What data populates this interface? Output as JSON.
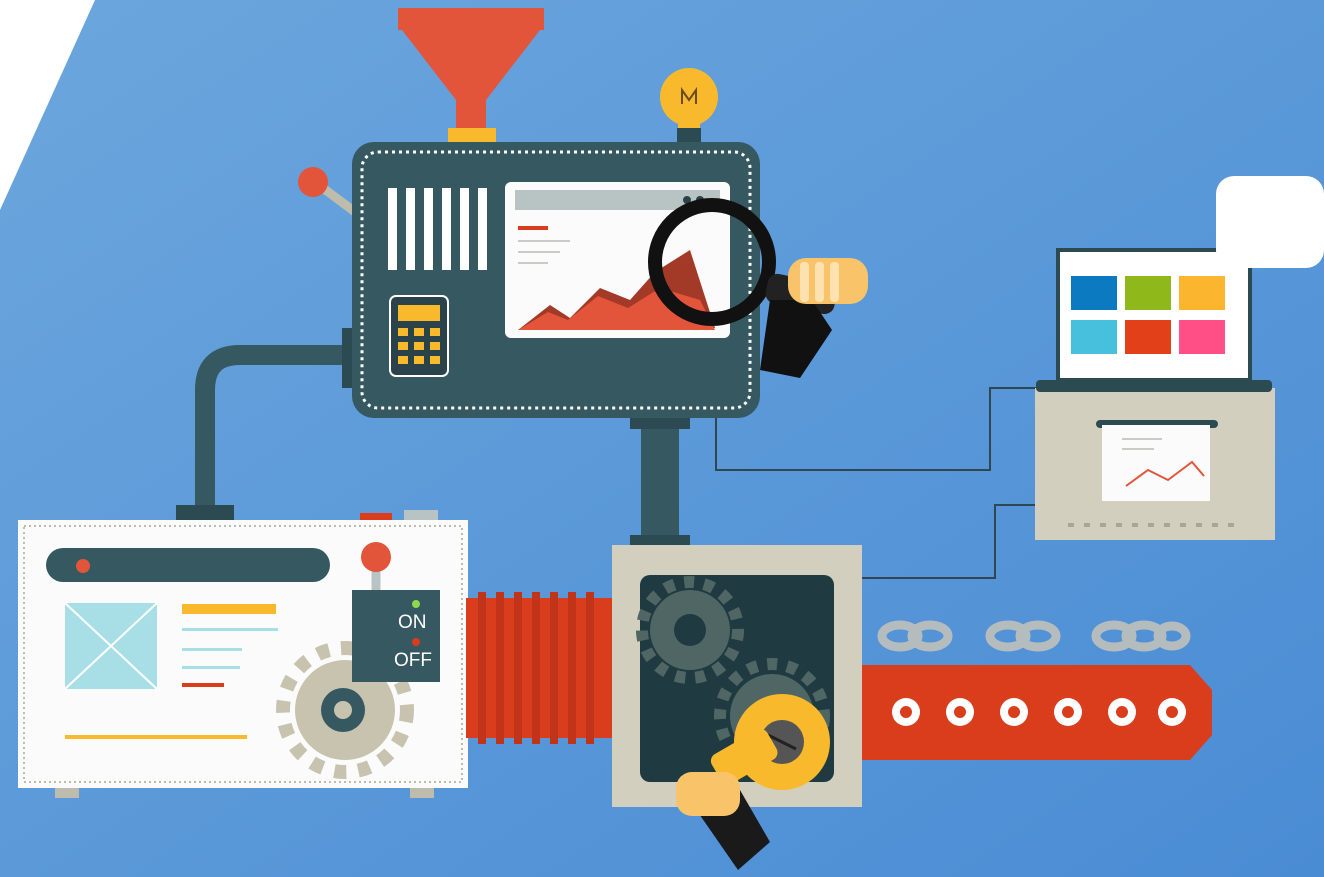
{
  "machine_panel": {
    "switch": {
      "on_label": "ON",
      "off_label": "OFF"
    }
  },
  "colors": {
    "background": "#4d91d6",
    "machine_body": "#355861",
    "funnel": "#e2553b",
    "conveyor": "#d93d1c",
    "accent_yellow": "#f9b92c",
    "panel_beige": "#d2cfbf",
    "screen_white": "#fbfbfb",
    "tile_colors": [
      "#0b7ac0",
      "#8fb81b",
      "#fbb52e",
      "#47c0de",
      "#e24018",
      "#ff4f86"
    ]
  },
  "icons": [
    "funnel-icon",
    "light-bulb-icon",
    "lever-icon",
    "calculator-icon",
    "chart-screen-icon",
    "magnifying-glass-icon",
    "hand-icon",
    "gear-icon",
    "wrench-icon",
    "chain-icon",
    "laptop-icon",
    "speech-bubble-icon",
    "power-switch-icon",
    "image-placeholder-icon"
  ]
}
